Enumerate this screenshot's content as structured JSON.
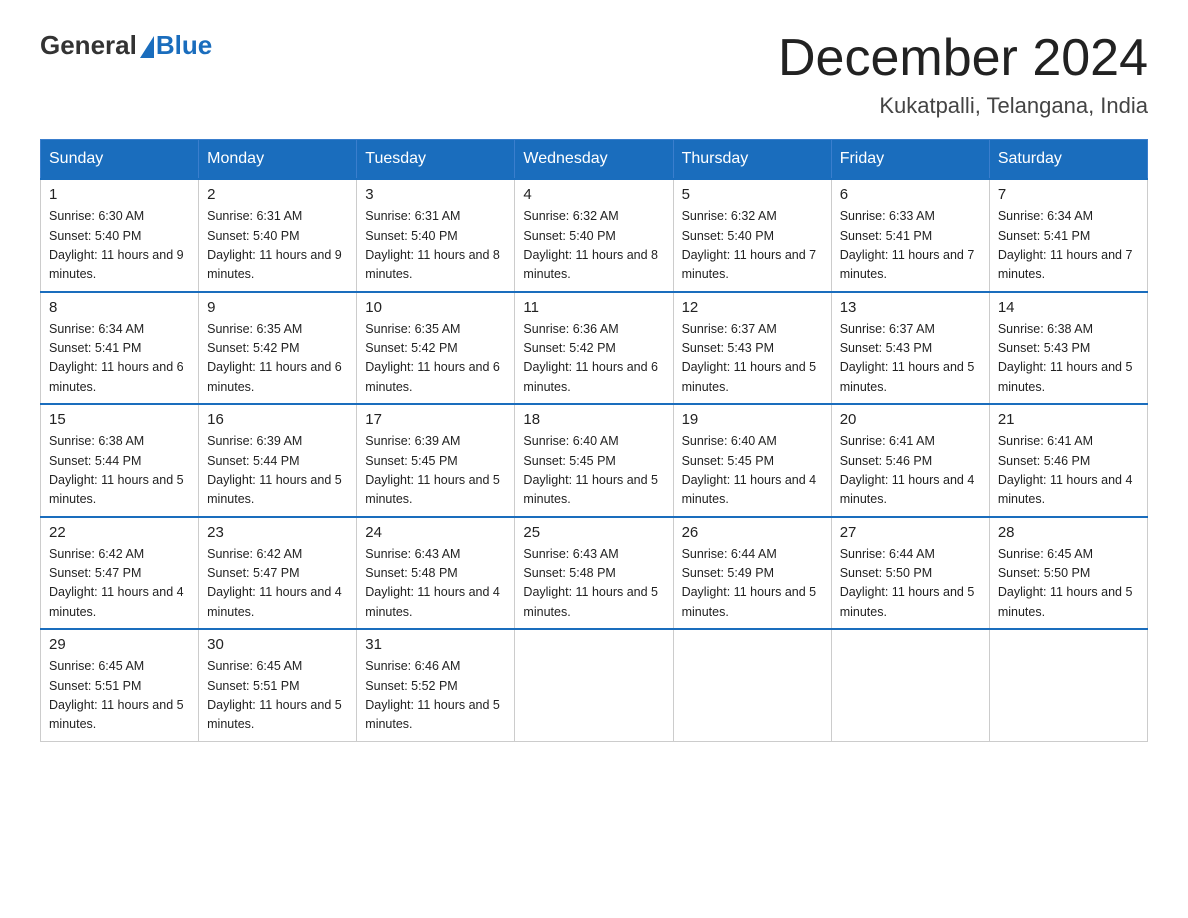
{
  "header": {
    "logo_general": "General",
    "logo_blue": "Blue",
    "month_title": "December 2024",
    "location": "Kukatpalli, Telangana, India"
  },
  "days_of_week": [
    "Sunday",
    "Monday",
    "Tuesday",
    "Wednesday",
    "Thursday",
    "Friday",
    "Saturday"
  ],
  "weeks": [
    [
      {
        "day": "1",
        "sunrise": "6:30 AM",
        "sunset": "5:40 PM",
        "daylight": "11 hours and 9 minutes."
      },
      {
        "day": "2",
        "sunrise": "6:31 AM",
        "sunset": "5:40 PM",
        "daylight": "11 hours and 9 minutes."
      },
      {
        "day": "3",
        "sunrise": "6:31 AM",
        "sunset": "5:40 PM",
        "daylight": "11 hours and 8 minutes."
      },
      {
        "day": "4",
        "sunrise": "6:32 AM",
        "sunset": "5:40 PM",
        "daylight": "11 hours and 8 minutes."
      },
      {
        "day": "5",
        "sunrise": "6:32 AM",
        "sunset": "5:40 PM",
        "daylight": "11 hours and 7 minutes."
      },
      {
        "day": "6",
        "sunrise": "6:33 AM",
        "sunset": "5:41 PM",
        "daylight": "11 hours and 7 minutes."
      },
      {
        "day": "7",
        "sunrise": "6:34 AM",
        "sunset": "5:41 PM",
        "daylight": "11 hours and 7 minutes."
      }
    ],
    [
      {
        "day": "8",
        "sunrise": "6:34 AM",
        "sunset": "5:41 PM",
        "daylight": "11 hours and 6 minutes."
      },
      {
        "day": "9",
        "sunrise": "6:35 AM",
        "sunset": "5:42 PM",
        "daylight": "11 hours and 6 minutes."
      },
      {
        "day": "10",
        "sunrise": "6:35 AM",
        "sunset": "5:42 PM",
        "daylight": "11 hours and 6 minutes."
      },
      {
        "day": "11",
        "sunrise": "6:36 AM",
        "sunset": "5:42 PM",
        "daylight": "11 hours and 6 minutes."
      },
      {
        "day": "12",
        "sunrise": "6:37 AM",
        "sunset": "5:43 PM",
        "daylight": "11 hours and 5 minutes."
      },
      {
        "day": "13",
        "sunrise": "6:37 AM",
        "sunset": "5:43 PM",
        "daylight": "11 hours and 5 minutes."
      },
      {
        "day": "14",
        "sunrise": "6:38 AM",
        "sunset": "5:43 PM",
        "daylight": "11 hours and 5 minutes."
      }
    ],
    [
      {
        "day": "15",
        "sunrise": "6:38 AM",
        "sunset": "5:44 PM",
        "daylight": "11 hours and 5 minutes."
      },
      {
        "day": "16",
        "sunrise": "6:39 AM",
        "sunset": "5:44 PM",
        "daylight": "11 hours and 5 minutes."
      },
      {
        "day": "17",
        "sunrise": "6:39 AM",
        "sunset": "5:45 PM",
        "daylight": "11 hours and 5 minutes."
      },
      {
        "day": "18",
        "sunrise": "6:40 AM",
        "sunset": "5:45 PM",
        "daylight": "11 hours and 5 minutes."
      },
      {
        "day": "19",
        "sunrise": "6:40 AM",
        "sunset": "5:45 PM",
        "daylight": "11 hours and 4 minutes."
      },
      {
        "day": "20",
        "sunrise": "6:41 AM",
        "sunset": "5:46 PM",
        "daylight": "11 hours and 4 minutes."
      },
      {
        "day": "21",
        "sunrise": "6:41 AM",
        "sunset": "5:46 PM",
        "daylight": "11 hours and 4 minutes."
      }
    ],
    [
      {
        "day": "22",
        "sunrise": "6:42 AM",
        "sunset": "5:47 PM",
        "daylight": "11 hours and 4 minutes."
      },
      {
        "day": "23",
        "sunrise": "6:42 AM",
        "sunset": "5:47 PM",
        "daylight": "11 hours and 4 minutes."
      },
      {
        "day": "24",
        "sunrise": "6:43 AM",
        "sunset": "5:48 PM",
        "daylight": "11 hours and 4 minutes."
      },
      {
        "day": "25",
        "sunrise": "6:43 AM",
        "sunset": "5:48 PM",
        "daylight": "11 hours and 5 minutes."
      },
      {
        "day": "26",
        "sunrise": "6:44 AM",
        "sunset": "5:49 PM",
        "daylight": "11 hours and 5 minutes."
      },
      {
        "day": "27",
        "sunrise": "6:44 AM",
        "sunset": "5:50 PM",
        "daylight": "11 hours and 5 minutes."
      },
      {
        "day": "28",
        "sunrise": "6:45 AM",
        "sunset": "5:50 PM",
        "daylight": "11 hours and 5 minutes."
      }
    ],
    [
      {
        "day": "29",
        "sunrise": "6:45 AM",
        "sunset": "5:51 PM",
        "daylight": "11 hours and 5 minutes."
      },
      {
        "day": "30",
        "sunrise": "6:45 AM",
        "sunset": "5:51 PM",
        "daylight": "11 hours and 5 minutes."
      },
      {
        "day": "31",
        "sunrise": "6:46 AM",
        "sunset": "5:52 PM",
        "daylight": "11 hours and 5 minutes."
      },
      null,
      null,
      null,
      null
    ]
  ]
}
